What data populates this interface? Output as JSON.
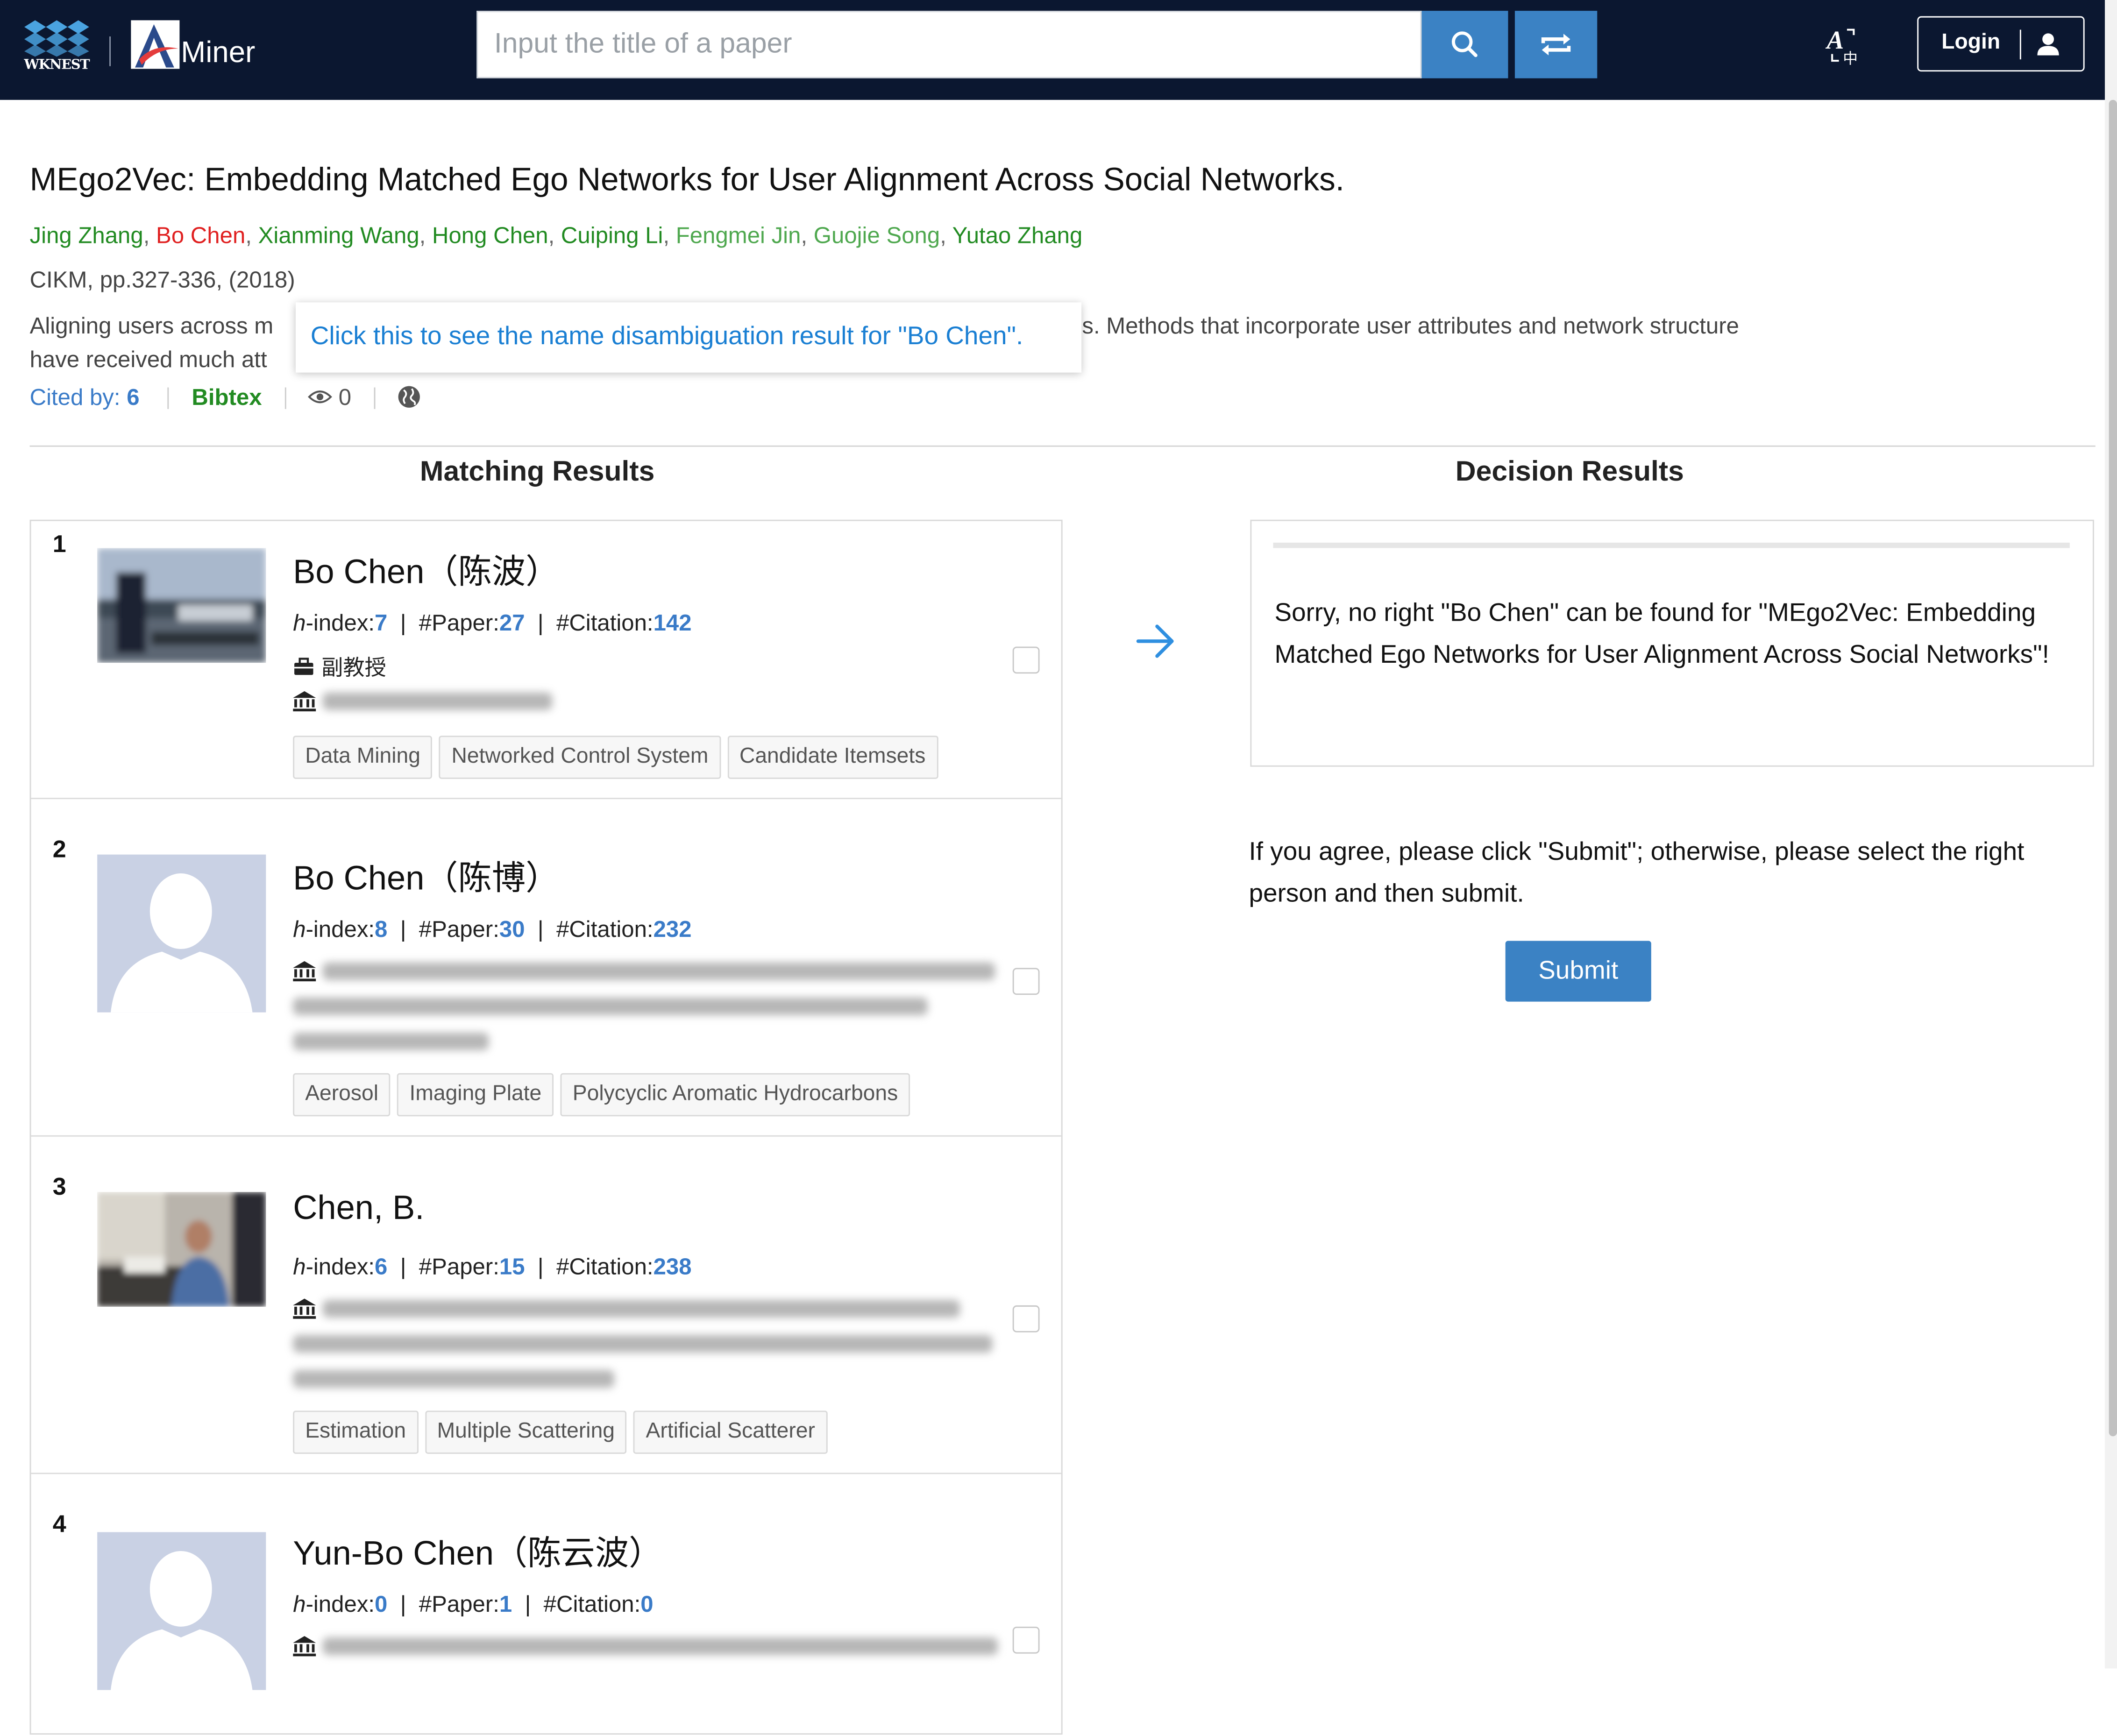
{
  "header": {
    "logo_wknest": "WKNEST",
    "logo_aminer": "Miner",
    "search_placeholder": "Input the title of a paper",
    "login_label": "Login",
    "colors": {
      "bar": "#0b1730",
      "accent": "#3b82c4"
    },
    "icons": [
      "search-icon",
      "swap-icon",
      "translate-icon",
      "user-icon"
    ]
  },
  "paper": {
    "title": "MEgo2Vec: Embedding Matched Ego Networks for User Alignment Across Social Networks.",
    "authors": [
      {
        "name": "Jing Zhang",
        "style": "green"
      },
      {
        "name": "Bo Chen",
        "style": "red"
      },
      {
        "name": "Xianming Wang",
        "style": "green"
      },
      {
        "name": "Hong Chen",
        "style": "green"
      },
      {
        "name": "Cuiping Li",
        "style": "green"
      },
      {
        "name": "Fengmei Jin",
        "style": "light"
      },
      {
        "name": "Guojie Song",
        "style": "light"
      },
      {
        "name": "Yutao Zhang",
        "style": "green"
      }
    ],
    "author_separator": ",",
    "venue": "CIKM, pp.327-336, (2018)",
    "abstract_line1": "Aligning users across m                                                                                          data mining applications. Methods that incorporate user attributes and network structure",
    "abstract_line2": "have received much att                                                                                         oise from...",
    "tooltip": "Click this to see the name disambiguation result for \"Bo Chen\".",
    "cited_label": "Cited by:",
    "cited_count": "6",
    "bibtex": "Bibtex",
    "views": "0"
  },
  "columns": {
    "matching": "Matching Results",
    "decision": "Decision Results"
  },
  "candidates": [
    {
      "num": "1",
      "name": "Bo Chen（陈波）",
      "hindex_label": "h",
      "hindex_suffix": "-index:",
      "hindex": "7",
      "paper_label": "#Paper:",
      "papers": "27",
      "citation_label": "#Citation:",
      "citations": "142",
      "position": "副教授",
      "tags": [
        "Data Mining",
        "Networked Control System",
        "Candidate Itemsets"
      ]
    },
    {
      "num": "2",
      "name": "Bo Chen（陈博）",
      "hindex_label": "h",
      "hindex_suffix": "-index:",
      "hindex": "8",
      "paper_label": "#Paper:",
      "papers": "30",
      "citation_label": "#Citation:",
      "citations": "232",
      "tags": [
        "Aerosol",
        "Imaging Plate",
        "Polycyclic Aromatic Hydrocarbons"
      ]
    },
    {
      "num": "3",
      "name": "Chen, B.",
      "hindex_label": "h",
      "hindex_suffix": "-index:",
      "hindex": "6",
      "paper_label": "#Paper:",
      "papers": "15",
      "citation_label": "#Citation:",
      "citations": "238",
      "tags": [
        "Estimation",
        "Multiple Scattering",
        "Artificial Scatterer"
      ]
    },
    {
      "num": "4",
      "name": "Yun-Bo Chen（陈云波）",
      "hindex_label": "h",
      "hindex_suffix": "-index:",
      "hindex": "0",
      "paper_label": "#Paper:",
      "papers": "1",
      "citation_label": "#Citation:",
      "citations": "0",
      "tags": []
    }
  ],
  "decision": {
    "progress": 0,
    "message": "Sorry, no right \"Bo Chen\" can be found for \"MEgo2Vec: Embedding Matched Ego Networks for User Alignment Across Social Networks\"!",
    "instruction": "If you agree, please click \"Submit\"; otherwise, please select the right person and then submit.",
    "submit_label": "Submit"
  }
}
